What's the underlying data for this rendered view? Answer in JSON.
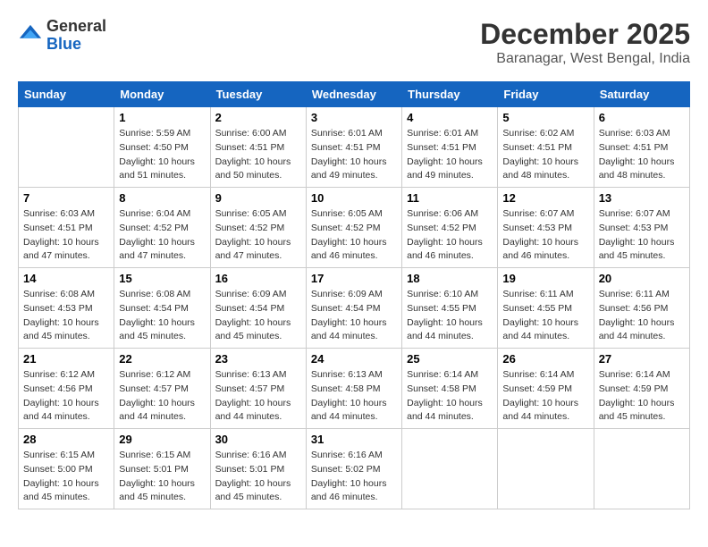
{
  "logo": {
    "general": "General",
    "blue": "Blue"
  },
  "title": {
    "month_year": "December 2025",
    "location": "Baranagar, West Bengal, India"
  },
  "headers": [
    "Sunday",
    "Monday",
    "Tuesday",
    "Wednesday",
    "Thursday",
    "Friday",
    "Saturday"
  ],
  "weeks": [
    [
      {
        "day": "",
        "sunrise": "",
        "sunset": "",
        "daylight": ""
      },
      {
        "day": "1",
        "sunrise": "Sunrise: 5:59 AM",
        "sunset": "Sunset: 4:50 PM",
        "daylight": "Daylight: 10 hours and 51 minutes."
      },
      {
        "day": "2",
        "sunrise": "Sunrise: 6:00 AM",
        "sunset": "Sunset: 4:51 PM",
        "daylight": "Daylight: 10 hours and 50 minutes."
      },
      {
        "day": "3",
        "sunrise": "Sunrise: 6:01 AM",
        "sunset": "Sunset: 4:51 PM",
        "daylight": "Daylight: 10 hours and 49 minutes."
      },
      {
        "day": "4",
        "sunrise": "Sunrise: 6:01 AM",
        "sunset": "Sunset: 4:51 PM",
        "daylight": "Daylight: 10 hours and 49 minutes."
      },
      {
        "day": "5",
        "sunrise": "Sunrise: 6:02 AM",
        "sunset": "Sunset: 4:51 PM",
        "daylight": "Daylight: 10 hours and 48 minutes."
      },
      {
        "day": "6",
        "sunrise": "Sunrise: 6:03 AM",
        "sunset": "Sunset: 4:51 PM",
        "daylight": "Daylight: 10 hours and 48 minutes."
      }
    ],
    [
      {
        "day": "7",
        "sunrise": "Sunrise: 6:03 AM",
        "sunset": "Sunset: 4:51 PM",
        "daylight": "Daylight: 10 hours and 47 minutes."
      },
      {
        "day": "8",
        "sunrise": "Sunrise: 6:04 AM",
        "sunset": "Sunset: 4:52 PM",
        "daylight": "Daylight: 10 hours and 47 minutes."
      },
      {
        "day": "9",
        "sunrise": "Sunrise: 6:05 AM",
        "sunset": "Sunset: 4:52 PM",
        "daylight": "Daylight: 10 hours and 47 minutes."
      },
      {
        "day": "10",
        "sunrise": "Sunrise: 6:05 AM",
        "sunset": "Sunset: 4:52 PM",
        "daylight": "Daylight: 10 hours and 46 minutes."
      },
      {
        "day": "11",
        "sunrise": "Sunrise: 6:06 AM",
        "sunset": "Sunset: 4:52 PM",
        "daylight": "Daylight: 10 hours and 46 minutes."
      },
      {
        "day": "12",
        "sunrise": "Sunrise: 6:07 AM",
        "sunset": "Sunset: 4:53 PM",
        "daylight": "Daylight: 10 hours and 46 minutes."
      },
      {
        "day": "13",
        "sunrise": "Sunrise: 6:07 AM",
        "sunset": "Sunset: 4:53 PM",
        "daylight": "Daylight: 10 hours and 45 minutes."
      }
    ],
    [
      {
        "day": "14",
        "sunrise": "Sunrise: 6:08 AM",
        "sunset": "Sunset: 4:53 PM",
        "daylight": "Daylight: 10 hours and 45 minutes."
      },
      {
        "day": "15",
        "sunrise": "Sunrise: 6:08 AM",
        "sunset": "Sunset: 4:54 PM",
        "daylight": "Daylight: 10 hours and 45 minutes."
      },
      {
        "day": "16",
        "sunrise": "Sunrise: 6:09 AM",
        "sunset": "Sunset: 4:54 PM",
        "daylight": "Daylight: 10 hours and 45 minutes."
      },
      {
        "day": "17",
        "sunrise": "Sunrise: 6:09 AM",
        "sunset": "Sunset: 4:54 PM",
        "daylight": "Daylight: 10 hours and 44 minutes."
      },
      {
        "day": "18",
        "sunrise": "Sunrise: 6:10 AM",
        "sunset": "Sunset: 4:55 PM",
        "daylight": "Daylight: 10 hours and 44 minutes."
      },
      {
        "day": "19",
        "sunrise": "Sunrise: 6:11 AM",
        "sunset": "Sunset: 4:55 PM",
        "daylight": "Daylight: 10 hours and 44 minutes."
      },
      {
        "day": "20",
        "sunrise": "Sunrise: 6:11 AM",
        "sunset": "Sunset: 4:56 PM",
        "daylight": "Daylight: 10 hours and 44 minutes."
      }
    ],
    [
      {
        "day": "21",
        "sunrise": "Sunrise: 6:12 AM",
        "sunset": "Sunset: 4:56 PM",
        "daylight": "Daylight: 10 hours and 44 minutes."
      },
      {
        "day": "22",
        "sunrise": "Sunrise: 6:12 AM",
        "sunset": "Sunset: 4:57 PM",
        "daylight": "Daylight: 10 hours and 44 minutes."
      },
      {
        "day": "23",
        "sunrise": "Sunrise: 6:13 AM",
        "sunset": "Sunset: 4:57 PM",
        "daylight": "Daylight: 10 hours and 44 minutes."
      },
      {
        "day": "24",
        "sunrise": "Sunrise: 6:13 AM",
        "sunset": "Sunset: 4:58 PM",
        "daylight": "Daylight: 10 hours and 44 minutes."
      },
      {
        "day": "25",
        "sunrise": "Sunrise: 6:14 AM",
        "sunset": "Sunset: 4:58 PM",
        "daylight": "Daylight: 10 hours and 44 minutes."
      },
      {
        "day": "26",
        "sunrise": "Sunrise: 6:14 AM",
        "sunset": "Sunset: 4:59 PM",
        "daylight": "Daylight: 10 hours and 44 minutes."
      },
      {
        "day": "27",
        "sunrise": "Sunrise: 6:14 AM",
        "sunset": "Sunset: 4:59 PM",
        "daylight": "Daylight: 10 hours and 45 minutes."
      }
    ],
    [
      {
        "day": "28",
        "sunrise": "Sunrise: 6:15 AM",
        "sunset": "Sunset: 5:00 PM",
        "daylight": "Daylight: 10 hours and 45 minutes."
      },
      {
        "day": "29",
        "sunrise": "Sunrise: 6:15 AM",
        "sunset": "Sunset: 5:01 PM",
        "daylight": "Daylight: 10 hours and 45 minutes."
      },
      {
        "day": "30",
        "sunrise": "Sunrise: 6:16 AM",
        "sunset": "Sunset: 5:01 PM",
        "daylight": "Daylight: 10 hours and 45 minutes."
      },
      {
        "day": "31",
        "sunrise": "Sunrise: 6:16 AM",
        "sunset": "Sunset: 5:02 PM",
        "daylight": "Daylight: 10 hours and 46 minutes."
      },
      {
        "day": "",
        "sunrise": "",
        "sunset": "",
        "daylight": ""
      },
      {
        "day": "",
        "sunrise": "",
        "sunset": "",
        "daylight": ""
      },
      {
        "day": "",
        "sunrise": "",
        "sunset": "",
        "daylight": ""
      }
    ]
  ]
}
